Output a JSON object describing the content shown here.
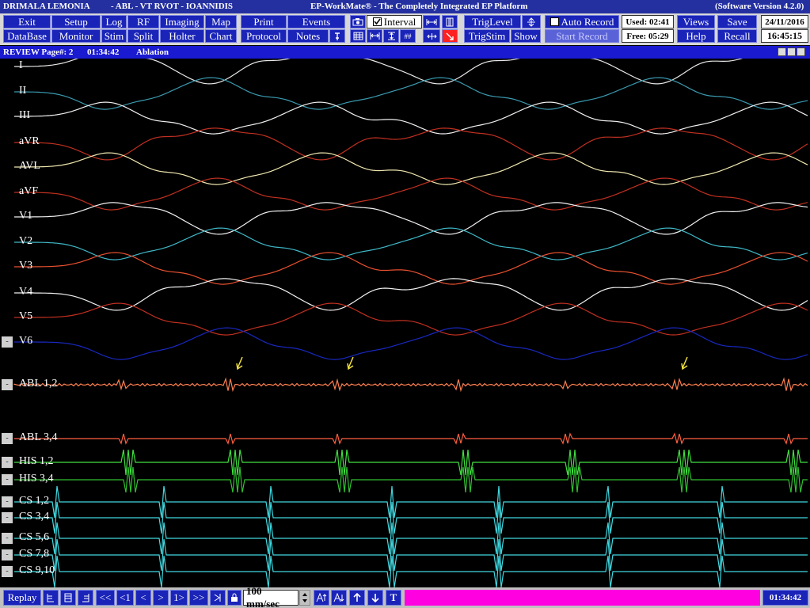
{
  "title": {
    "patient": "DRIMALA LEMONIA",
    "study": "- ABL - VT RVOT - IOANNIDIS",
    "app": "EP-WorkMate®  -  The Completely Integrated EP Platform",
    "version": "(Software Version 4.2.0)"
  },
  "toolbar": {
    "row1": [
      "Exit",
      "Setup",
      "Log",
      "RF",
      "Imaging",
      "Map",
      "Print",
      "Events"
    ],
    "row2": [
      "DataBase",
      "Monitor",
      "Stim",
      "Split",
      "Holter",
      "Chart",
      "Protocol",
      "Notes"
    ],
    "interval_label": "Interval",
    "trig_level": "TrigLevel",
    "trig_stim": "TrigStim",
    "show": "Show",
    "auto_record": "Auto Record",
    "start_record": "Start Record",
    "used": "Used: 02:41",
    "free": "Free: 05:29",
    "views": "Views",
    "help": "Help",
    "save": "Save",
    "recall": "Recall",
    "date": "24/11/2016",
    "time": "16:45:15"
  },
  "review": {
    "label": "REVIEW Page#: 2",
    "timestamp": "01:34:42",
    "mode": "Ablation"
  },
  "channels": [
    {
      "label": "I",
      "color": "#e8e8e8"
    },
    {
      "label": "II",
      "color": "#3a9ab0"
    },
    {
      "label": "III",
      "color": "#f0f0f0"
    },
    {
      "label": "aVR",
      "color": "#c03020"
    },
    {
      "label": "AVL",
      "color": "#f0e8b0"
    },
    {
      "label": "aVF",
      "color": "#c03020"
    },
    {
      "label": "V1",
      "color": "#f0f0f0"
    },
    {
      "label": "V2",
      "color": "#40b8c8"
    },
    {
      "label": "V3",
      "color": "#e85030"
    },
    {
      "label": "V4",
      "color": "#f0f0f0"
    },
    {
      "label": "V5",
      "color": "#c03020"
    },
    {
      "label": "V6",
      "color": "#1828c0"
    },
    {
      "label": "ABL 1,2",
      "color": "#ff8050"
    },
    {
      "label": "ABL 3,4",
      "color": "#ff6040"
    },
    {
      "label": "HIS 1,2",
      "color": "#40e040"
    },
    {
      "label": "HIS 3,4",
      "color": "#30c030"
    },
    {
      "label": "CS 1,2",
      "color": "#40d8e0"
    },
    {
      "label": "CS 3,4",
      "color": "#40d8e0"
    },
    {
      "label": "CS 5,6",
      "color": "#40d8e0"
    },
    {
      "label": "CS 7,8",
      "color": "#40d8e0"
    },
    {
      "label": "CS 9,10",
      "color": "#40d8e0"
    }
  ],
  "bottom": {
    "replay": "Replay",
    "nav": [
      "<<",
      "<1",
      "<",
      ">",
      "1>",
      ">>"
    ],
    "speed": "100 mm/sec",
    "marker_t": "T",
    "clock": "01:34:42"
  },
  "colors": {
    "button_blue": "#1a24b8",
    "title_blue": "#2430a0",
    "review_blue": "#1a1ad0",
    "accent_magenta": "#ff00e0",
    "arrow_yellow": "#f0e040"
  }
}
